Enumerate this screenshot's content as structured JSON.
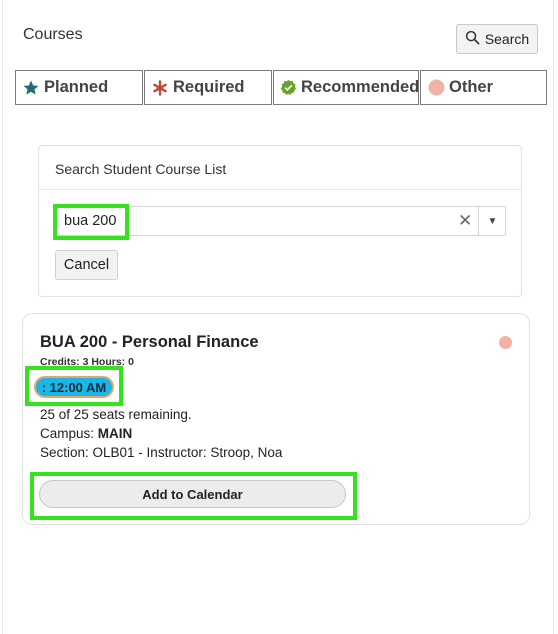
{
  "header": {
    "title": "Courses",
    "search_label": "Search",
    "search_icon": "search-icon"
  },
  "filters": [
    {
      "label": "Planned",
      "icon": "star-icon",
      "color": "#1c6e73"
    },
    {
      "label": "Required",
      "icon": "asterisk-icon",
      "color": "#b94a3b"
    },
    {
      "label": "Recommended",
      "icon": "check-badge-icon",
      "color": "#6aa12a"
    },
    {
      "label": "Other",
      "icon": "circle-icon",
      "color": "#f2b3a6"
    }
  ],
  "search_panel": {
    "heading": "Search Student Course List",
    "query": "bua 200",
    "clear_glyph": "✕",
    "cancel_label": "Cancel"
  },
  "course": {
    "title": "BUA 200 - Personal Finance",
    "credits_line": "Credits: 3 Hours: 0",
    "time": ": 12:00 AM",
    "seats": "25 of 25 seats remaining.",
    "campus_label": "Campus: ",
    "campus_value": "MAIN",
    "section": "Section: OLB01 - Instructor: Stroop, Noa",
    "category_dot": "Other",
    "add_label": "Add to Calendar"
  },
  "colors": {
    "highlight": "#34e31e",
    "time_pill": "#1ab6e8",
    "other_dot": "#f2b3a6"
  }
}
